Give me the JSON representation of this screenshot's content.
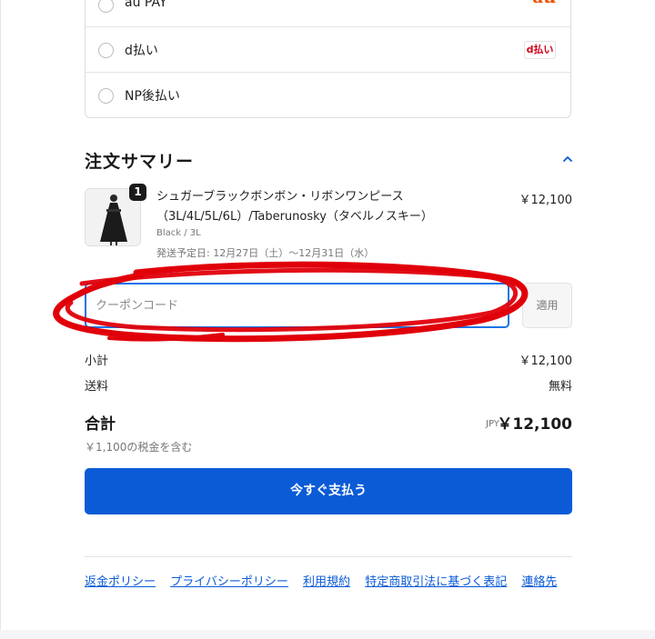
{
  "payment_methods": [
    {
      "label": "au PAY",
      "logo": "au"
    },
    {
      "label": "d払い",
      "logo": "d払い"
    },
    {
      "label": "NP後払い",
      "logo": ""
    }
  ],
  "summary": {
    "title": "注文サマリー",
    "item": {
      "quantity": "1",
      "name": "シュガーブラックボンボン・リボンワンピース（3L/4L/5L/6L）/Taberunosky（タベルノスキー）",
      "variant": "Black / 3L",
      "delivery": "発送予定日: 12月27日（土）〜12月31日（水）",
      "price": "￥12,100"
    }
  },
  "coupon": {
    "placeholder": "クーポンコード",
    "apply_label": "適用"
  },
  "totals": {
    "subtotal_label": "小計",
    "subtotal_value": "￥12,100",
    "shipping_label": "送料",
    "shipping_value": "無料",
    "total_label": "合計",
    "currency": "JPY",
    "total_value": "￥12,100",
    "tax_note": "￥1,100の税金を含む"
  },
  "pay_button": "今すぐ支払う",
  "footer_links": [
    "返金ポリシー",
    "プライバシーポリシー",
    "利用規約",
    "特定商取引法に基づく表記",
    "連絡先"
  ],
  "colors": {
    "accent": "#0b5bd7",
    "focus_border": "#1773e8",
    "annotation": "#e0000a"
  }
}
